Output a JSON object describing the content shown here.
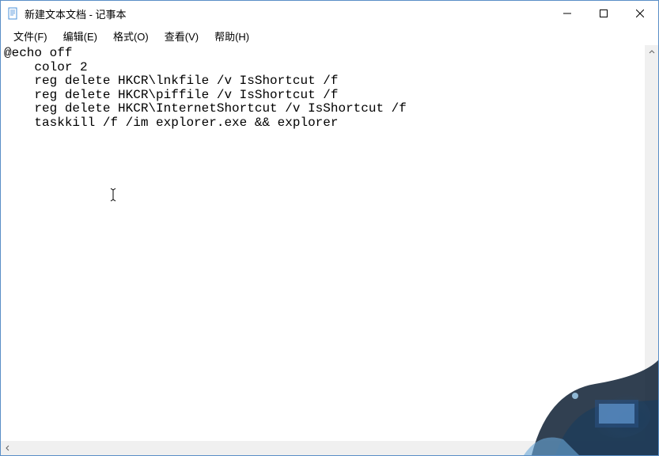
{
  "window": {
    "title": "新建文本文档 - 记事本"
  },
  "menu": {
    "file": "文件(F)",
    "edit": "编辑(E)",
    "format": "格式(O)",
    "view": "查看(V)",
    "help": "帮助(H)"
  },
  "content": {
    "text": "@echo off\n    color 2\n    reg delete HKCR\\lnkfile /v IsShortcut /f\n    reg delete HKCR\\piffile /v IsShortcut /f\n    reg delete HKCR\\InternetShortcut /v IsShortcut /f\n    taskkill /f /im explorer.exe && explorer"
  }
}
